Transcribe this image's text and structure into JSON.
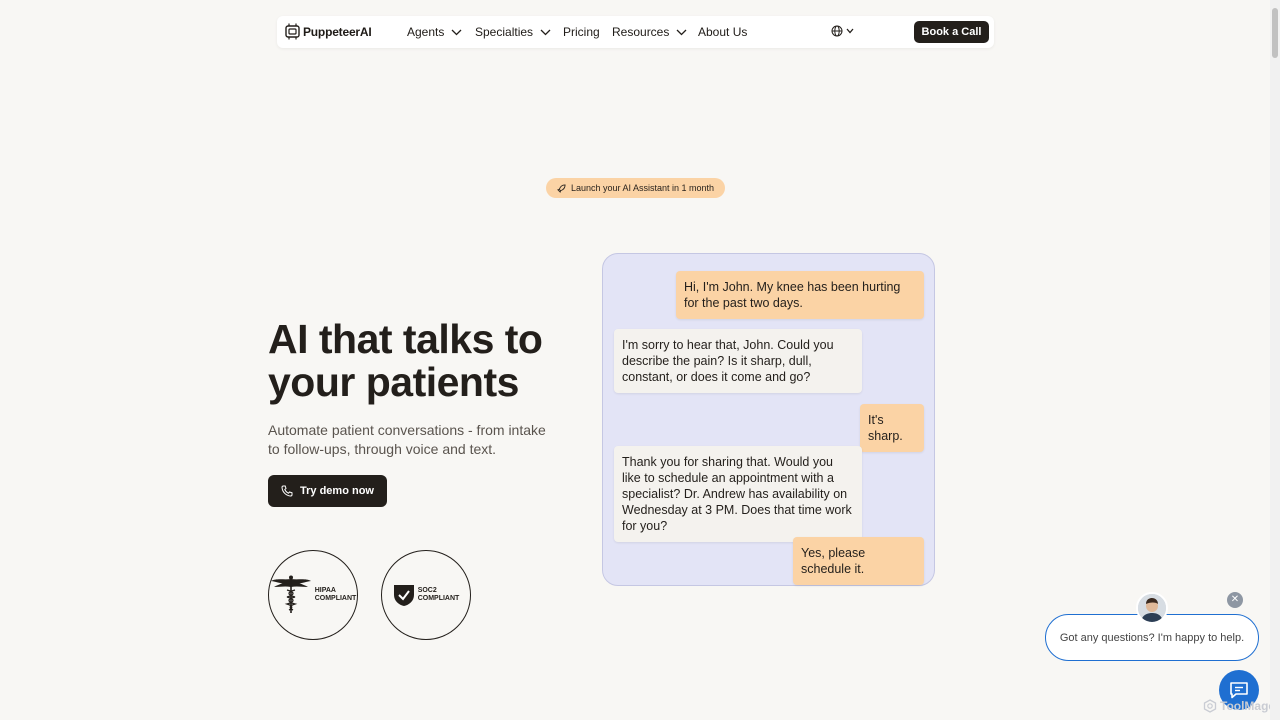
{
  "nav": {
    "logo_text": "PuppeteerAI",
    "items": [
      {
        "label": "Agents",
        "dropdown": true
      },
      {
        "label": "Specialties",
        "dropdown": true
      },
      {
        "label": "Pricing",
        "dropdown": false
      },
      {
        "label": "Resources",
        "dropdown": true
      },
      {
        "label": "About Us",
        "dropdown": false
      }
    ],
    "language_icon": "globe-icon",
    "cta_label": "Book a Call"
  },
  "badge": {
    "icon": "rocket-icon",
    "text": "Launch your AI Assistant in 1 month"
  },
  "hero": {
    "title_line1": "AI that talks to",
    "title_line2": "your patients",
    "subtitle": "Automate patient conversations - from intake to follow-ups, through voice and text.",
    "demo_button": "Try demo now"
  },
  "certifications": [
    {
      "name": "hipaa",
      "line1": "HIPAA",
      "line2": "COMPLIANT"
    },
    {
      "name": "soc2",
      "line1": "SOC2",
      "line2": "COMPLIANT"
    }
  ],
  "chat": {
    "messages": [
      {
        "role": "user",
        "text": "Hi, I'm John. My knee has been hurting for the past two days."
      },
      {
        "role": "bot",
        "text": "I'm sorry to hear that, John. Could you describe the pain? Is it sharp, dull, constant, or does it come and go?"
      },
      {
        "role": "user",
        "text": "It's sharp."
      },
      {
        "role": "bot",
        "text": "Thank you for sharing that. Would you like to schedule an appointment with a specialist? Dr. Andrew has availability on Wednesday at 3 PM. Does that time work for you?"
      },
      {
        "role": "user",
        "text": "Yes, please schedule it."
      }
    ]
  },
  "widget": {
    "message": "Got any questions? I'm happy to help.",
    "close_symbol": "✕",
    "watermark": "ToolMage"
  },
  "colors": {
    "background": "#f8f7f4",
    "dark": "#231f1b",
    "peach": "#fbd3a5",
    "chat_bg": "#e3e4f6",
    "widget_blue": "#1f6fd1"
  }
}
